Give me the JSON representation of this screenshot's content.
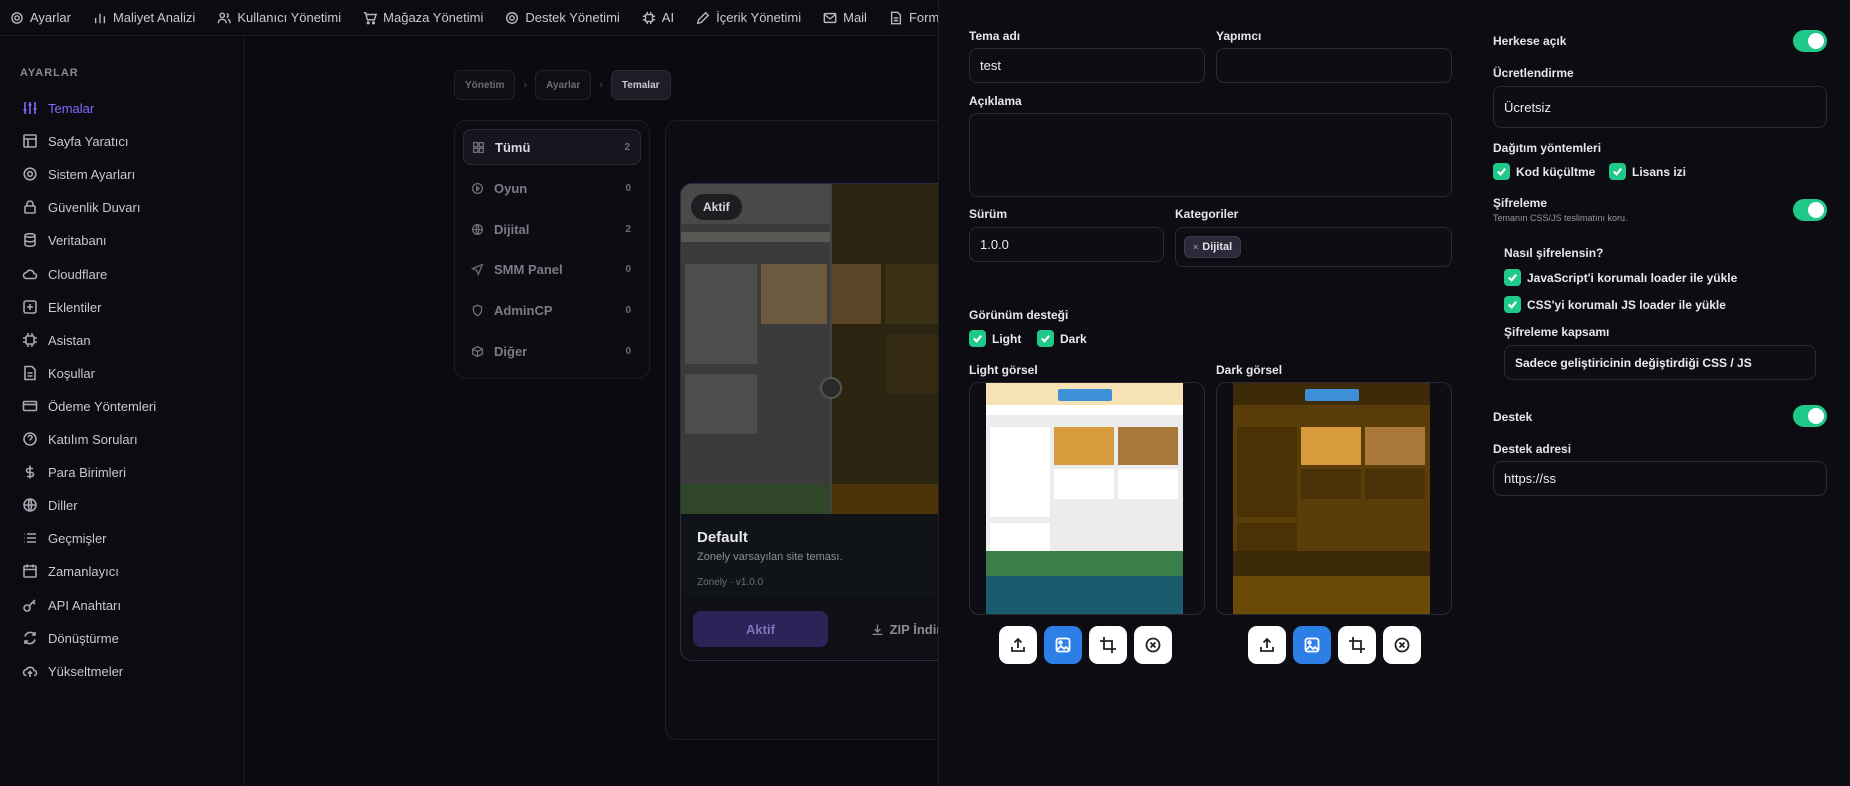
{
  "topnav": {
    "items": [
      {
        "label": "Ayarlar",
        "icon": "gear-icon"
      },
      {
        "label": "Maliyet Analizi",
        "icon": "bar-chart-icon"
      },
      {
        "label": "Kullanıcı Yönetimi",
        "icon": "users-icon"
      },
      {
        "label": "Mağaza Yönetimi",
        "icon": "cart-icon"
      },
      {
        "label": "Destek Yönetimi",
        "icon": "support-icon"
      },
      {
        "label": "AI",
        "icon": "chip-icon"
      },
      {
        "label": "İçerik Yönetimi",
        "icon": "pencil-icon"
      },
      {
        "label": "Mail",
        "icon": "mail-icon"
      },
      {
        "label": "Formla",
        "icon": "document-icon"
      }
    ]
  },
  "sidebar": {
    "section_title": "AYARLAR",
    "items": [
      {
        "label": "Temalar",
        "icon": "sliders-icon"
      },
      {
        "label": "Sayfa Yaratıcı",
        "icon": "layout-icon"
      },
      {
        "label": "Sistem Ayarları",
        "icon": "gear-icon"
      },
      {
        "label": "Güvenlik Duvarı",
        "icon": "lock-icon"
      },
      {
        "label": "Veritabanı",
        "icon": "database-icon"
      },
      {
        "label": "Cloudflare",
        "icon": "cloud-icon"
      },
      {
        "label": "Eklentiler",
        "icon": "plus-square-icon"
      },
      {
        "label": "Asistan",
        "icon": "chip-icon"
      },
      {
        "label": "Koşullar",
        "icon": "document-icon"
      },
      {
        "label": "Ödeme Yöntemleri",
        "icon": "credit-card-icon"
      },
      {
        "label": "Katılım Soruları",
        "icon": "question-icon"
      },
      {
        "label": "Para Birimleri",
        "icon": "dollar-icon"
      },
      {
        "label": "Diller",
        "icon": "globe-icon"
      },
      {
        "label": "Geçmişler",
        "icon": "list-icon"
      },
      {
        "label": "Zamanlayıcı",
        "icon": "calendar-icon"
      },
      {
        "label": "API Anahtarı",
        "icon": "key-icon"
      },
      {
        "label": "Dönüştürme",
        "icon": "refresh-icon"
      },
      {
        "label": "Yükseltmeler",
        "icon": "cloud-upload-icon"
      }
    ]
  },
  "breadcrumb": [
    "Yönetim",
    "Ayarlar",
    "Temalar"
  ],
  "filters": [
    {
      "label": "Tümü",
      "count": "2",
      "icon": "grid-icon"
    },
    {
      "label": "Oyun",
      "count": "0",
      "icon": "play-icon"
    },
    {
      "label": "Dijital",
      "count": "2",
      "icon": "globe-icon"
    },
    {
      "label": "SMM Panel",
      "count": "0",
      "icon": "send-icon"
    },
    {
      "label": "AdminCP",
      "count": "0",
      "icon": "shield-icon"
    },
    {
      "label": "Diğer",
      "count": "0",
      "icon": "box-icon"
    }
  ],
  "theme_card": {
    "badge": "Aktif",
    "title": "Default",
    "description": "Zonely varsayılan site teması.",
    "meta": "Zonely · v1.0.0",
    "active_button": "Aktif",
    "zip_button": "ZIP İndir"
  },
  "form": {
    "name_label": "Tema adı",
    "name_value": "test",
    "author_label": "Yapımcı",
    "author_value": "",
    "description_label": "Açıklama",
    "description_value": "",
    "version_label": "Sürüm",
    "version_value": "1.0.0",
    "categories_label": "Kategoriler",
    "category_chip": "Dijital",
    "appearance_label": "Görünüm desteği",
    "light_option": "Light",
    "dark_option": "Dark",
    "light_image_label": "Light görsel",
    "dark_image_label": "Dark görsel"
  },
  "settings": {
    "public_label": "Herkese açık",
    "public_on": true,
    "pricing_label": "Ücretlendirme",
    "pricing_value": "Ücretsiz",
    "distribution_label": "Dağıtım yöntemleri",
    "minify_option": "Kod küçültme",
    "license_option": "Lisans izi",
    "encryption_label": "Şifreleme",
    "encryption_sub": "Temanın CSS/JS teslimatını koru.",
    "encryption_on": true,
    "how_label": "Nasıl şifrelensin?",
    "js_option": "JavaScript'i korumalı loader ile yükle",
    "css_option": "CSS'yi korumalı JS loader ile yükle",
    "scope_label": "Şifreleme kapsamı",
    "scope_value": "Sadece geliştiricinin değiştirdiği CSS / JS",
    "support_label": "Destek",
    "support_on": true,
    "support_address_label": "Destek adresi",
    "support_address_value": "https://ss"
  },
  "colors": {
    "accent": "#7c6cff",
    "toggle": "#1ec98a",
    "tool_blue": "#2d7fe8"
  }
}
